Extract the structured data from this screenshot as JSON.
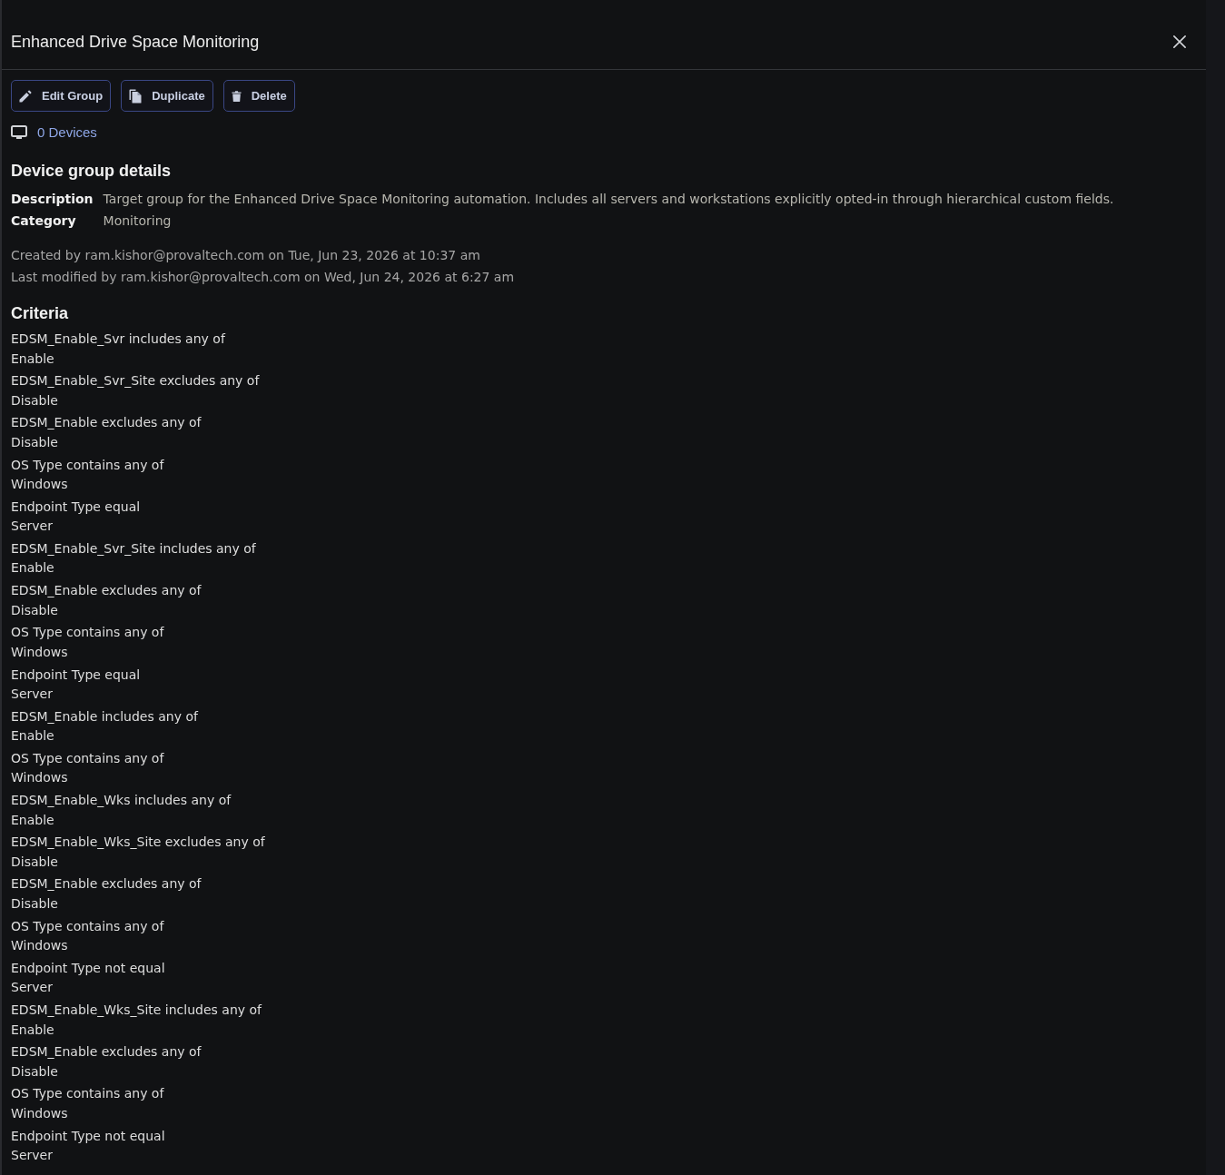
{
  "panel": {
    "title": "Enhanced Drive Space Monitoring"
  },
  "actions": [
    {
      "kind": "edit",
      "label": "Edit Group"
    },
    {
      "kind": "duplicate",
      "label": "Duplicate"
    },
    {
      "kind": "delete",
      "label": "Delete"
    }
  ],
  "devices": {
    "label": "0 Devices"
  },
  "details": {
    "heading": "Device group details",
    "fields": [
      {
        "label": "Description",
        "value": "Target group for the Enhanced Drive Space Monitoring automation. Includes all servers and workstations explicitly opted-in through hierarchical custom fields."
      },
      {
        "label": "Category",
        "value": "Monitoring"
      }
    ],
    "audit": [
      "Created by ram.kishor@provaltech.com on Tue, Jun 23, 2026 at 10:37 am",
      "Last modified by ram.kishor@provaltech.com on Wed, Jun 24, 2026 at 6:27 am"
    ]
  },
  "criteria": {
    "heading": "Criteria",
    "items": [
      {
        "condition": "EDSM_Enable_Svr includes any of",
        "value": "Enable"
      },
      {
        "condition": "EDSM_Enable_Svr_Site excludes any of",
        "value": "Disable"
      },
      {
        "condition": "EDSM_Enable excludes any of",
        "value": "Disable"
      },
      {
        "condition": "OS Type contains any of",
        "value": "Windows"
      },
      {
        "condition": "Endpoint Type equal",
        "value": "Server"
      },
      {
        "condition": "EDSM_Enable_Svr_Site includes any of",
        "value": "Enable"
      },
      {
        "condition": "EDSM_Enable excludes any of",
        "value": "Disable"
      },
      {
        "condition": "OS Type contains any of",
        "value": "Windows"
      },
      {
        "condition": "Endpoint Type equal",
        "value": "Server"
      },
      {
        "condition": "EDSM_Enable includes any of",
        "value": "Enable"
      },
      {
        "condition": "OS Type contains any of",
        "value": "Windows"
      },
      {
        "condition": "EDSM_Enable_Wks includes any of",
        "value": "Enable"
      },
      {
        "condition": "EDSM_Enable_Wks_Site excludes any of",
        "value": "Disable"
      },
      {
        "condition": "EDSM_Enable excludes any of",
        "value": "Disable"
      },
      {
        "condition": "OS Type contains any of",
        "value": "Windows"
      },
      {
        "condition": "Endpoint Type not equal",
        "value": "Server"
      },
      {
        "condition": "EDSM_Enable_Wks_Site includes any of",
        "value": "Enable"
      },
      {
        "condition": "EDSM_Enable excludes any of",
        "value": "Disable"
      },
      {
        "condition": "OS Type contains any of",
        "value": "Windows"
      },
      {
        "condition": "Endpoint Type not equal",
        "value": "Server"
      }
    ]
  }
}
